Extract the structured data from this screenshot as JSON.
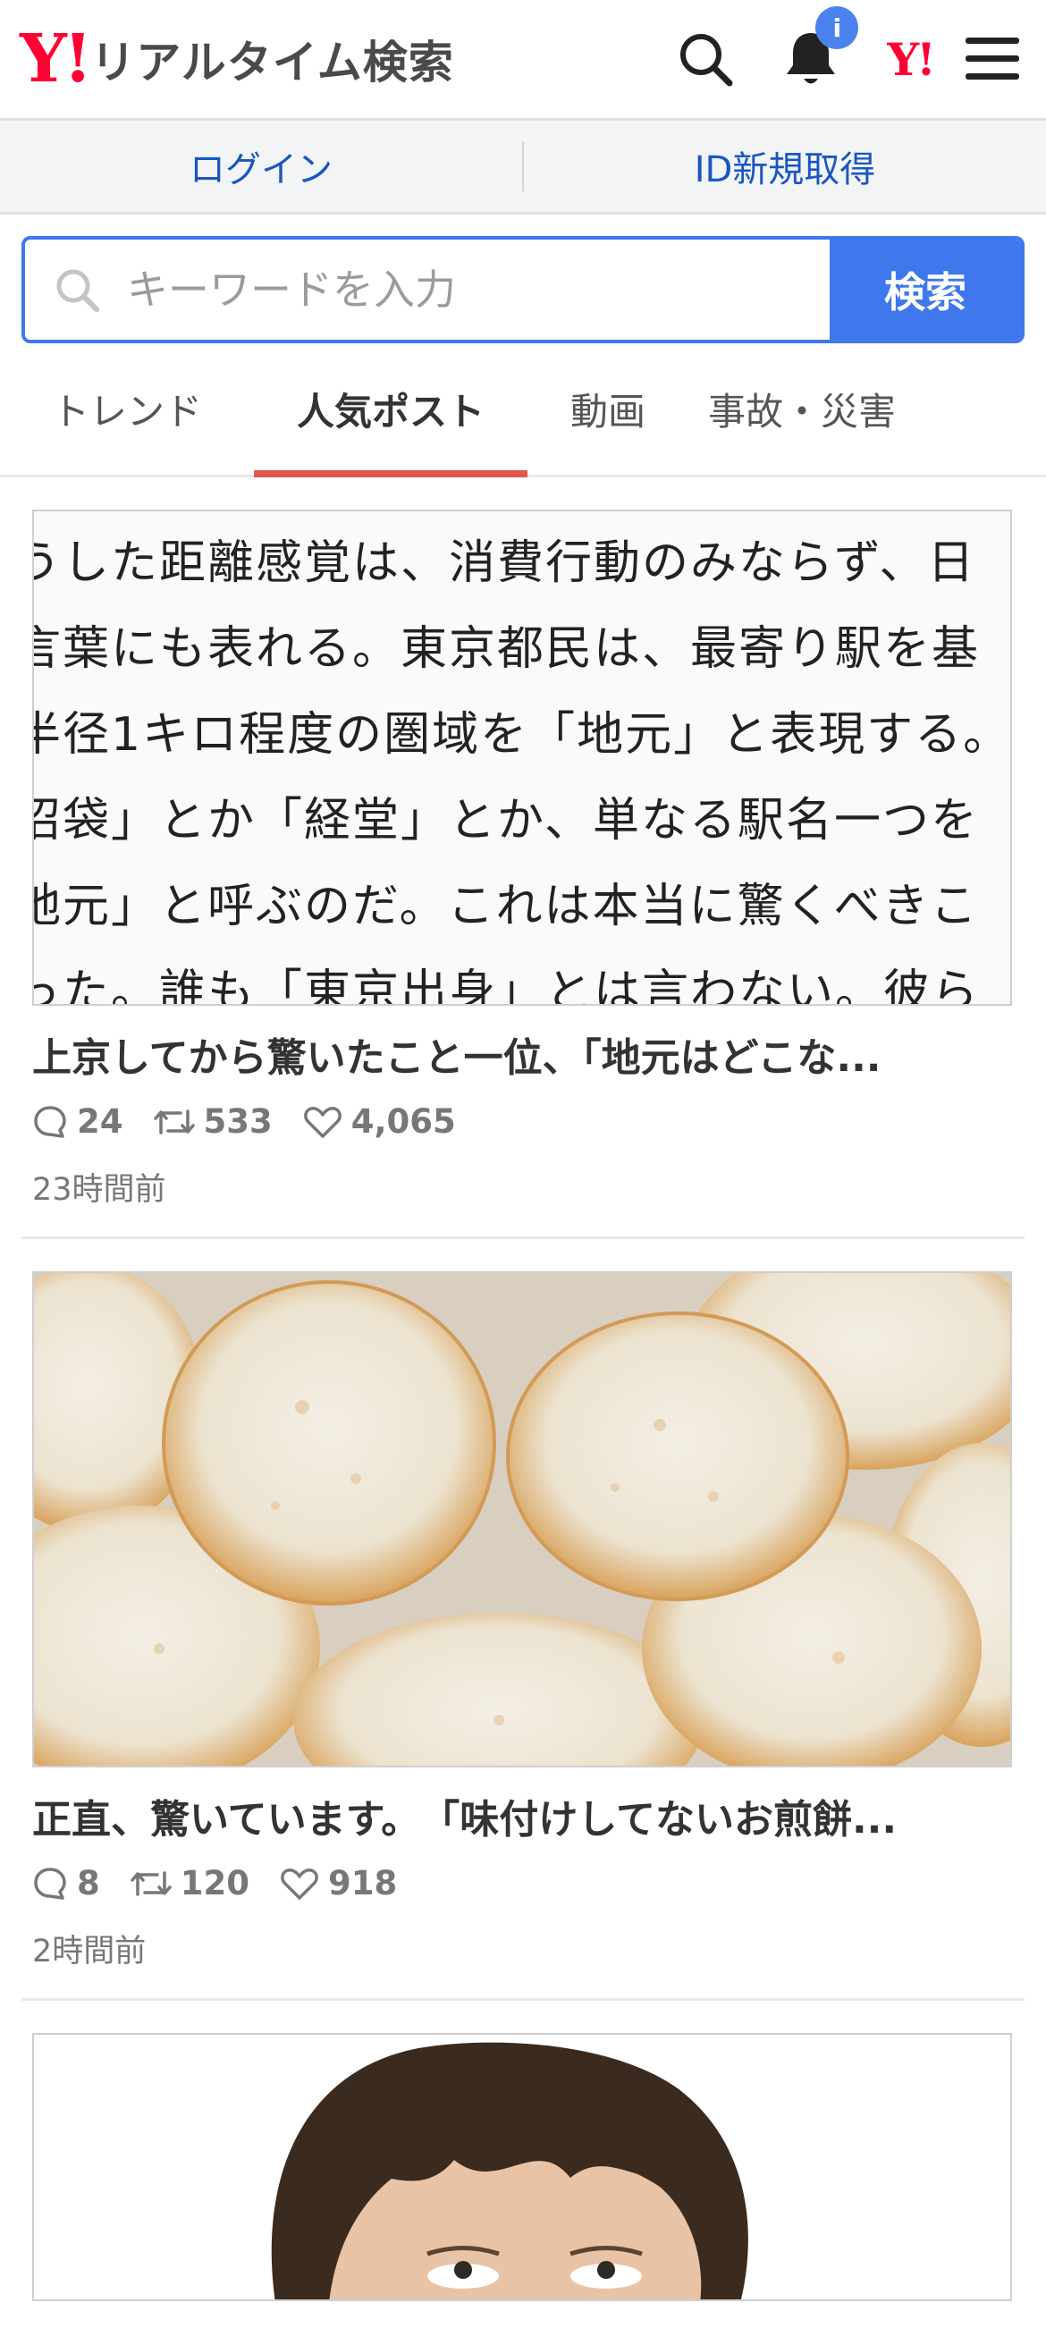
{
  "header": {
    "logo_mark": "Y!",
    "title": "リアルタイム検索",
    "notification_badge": "i",
    "yahoo_mark": "Y!"
  },
  "loginbar": {
    "login": "ログイン",
    "register": "ID新規取得"
  },
  "search": {
    "placeholder": "キーワードを入力",
    "button": "検索"
  },
  "tabs": [
    {
      "label": "トレンド",
      "active": false
    },
    {
      "label": "人気ポスト",
      "active": true
    },
    {
      "label": "動画",
      "active": false
    },
    {
      "label": "事故・災害",
      "active": false
    }
  ],
  "posts": [
    {
      "image_text": [
        "うした距離感覚は、消費行動のみならず、日",
        "言葉にも表れる。東京都民は、最寄り駅を基",
        "半径1キロ程度の圏域を「地元」と表現する。",
        "沼袋」とか「経堂」とか、単なる駅名一つを",
        "地元」と呼ぶのだ。これは本当に驚くべきこ",
        "った。誰も「東京出身」とは言わない。彼ら"
      ],
      "title": "上京してから驚いたこと一位、「地元はどこな...",
      "replies": "24",
      "reposts": "533",
      "likes": "4,065",
      "time": "23時間前"
    },
    {
      "title": "正直、驚いています。　「味付けしてないお煎餅...",
      "replies": "8",
      "reposts": "120",
      "likes": "918",
      "time": "2時間前"
    }
  ],
  "colors": {
    "brand": "#ff0033",
    "accent": "#3f78ec",
    "tab_indicator": "#e05750",
    "link": "#1a56c3"
  }
}
